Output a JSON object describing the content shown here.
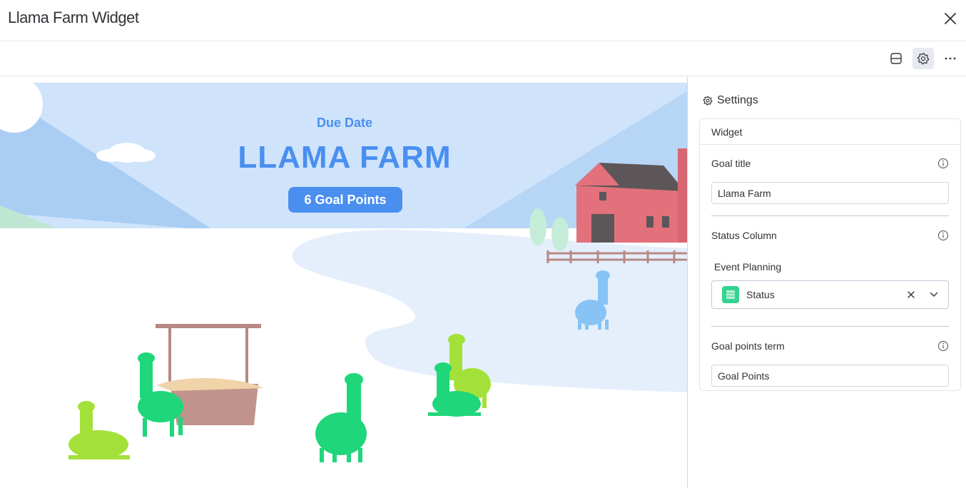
{
  "window": {
    "title": "Llama Farm Widget"
  },
  "widget": {
    "due_label": "Due Date",
    "farm_title": "LLAMA FARM",
    "goal_badge": "6 Goal Points"
  },
  "settings": {
    "heading": "Settings",
    "section": "Widget",
    "goal_title": {
      "label": "Goal title",
      "value": "Llama Farm"
    },
    "status_column": {
      "label": "Status Column",
      "board": "Event Planning",
      "selected": "Status"
    },
    "goal_points_term": {
      "label": "Goal points term",
      "value": "Goal Points"
    }
  },
  "colors": {
    "sky": "#cfe4fb",
    "mountain": "#a9cdf3",
    "accent_blue": "#4a8ff0",
    "barn_red": "#e2717b",
    "llama_green": "#1fd67a",
    "llama_lime": "#a3e13a",
    "llama_blue": "#87c3f5",
    "board_icon": "#33d391"
  },
  "icons": [
    "close-icon",
    "layout-icon",
    "gear-icon",
    "more-icon",
    "info-icon",
    "chevron-down-icon",
    "clear-icon"
  ]
}
